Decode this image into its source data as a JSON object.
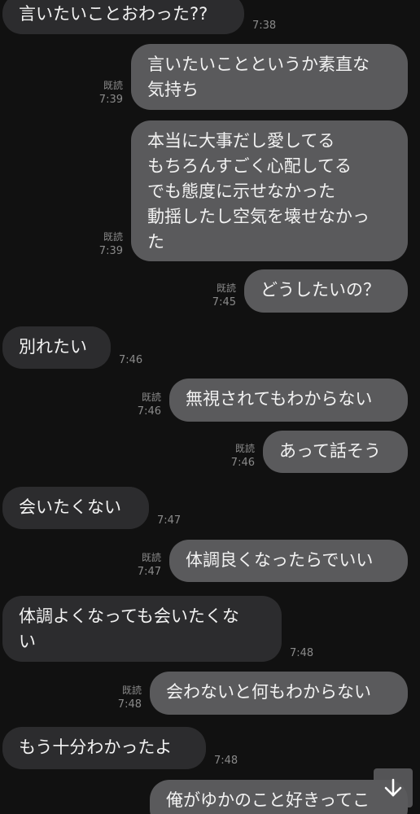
{
  "read_label": "既読",
  "messages": [
    {
      "side": "recv",
      "text": "言いたいことおわった??",
      "time": "7:38"
    },
    {
      "side": "sent",
      "text": "言いたいことというか素直な\n気持ち",
      "time": "7:39",
      "read": true
    },
    {
      "side": "sent",
      "text": "本当に大事だし愛してる\nもちろんすごく心配してる\nでも態度に示せなかった\n動揺したし空気を壊せなかっ\nた",
      "time": "7:39",
      "read": true
    },
    {
      "side": "sent",
      "text": "どうしたいの？",
      "time": "7:45",
      "read": true
    },
    {
      "side": "recv",
      "text": "別れたい",
      "time": "7:46"
    },
    {
      "side": "sent",
      "text": "無視されてもわからない",
      "time": "7:46",
      "read": true
    },
    {
      "side": "sent",
      "text": "あって話そう",
      "time": "7:46",
      "read": true
    },
    {
      "side": "recv",
      "text": "会いたくない",
      "time": "7:47"
    },
    {
      "side": "sent",
      "text": "体調良くなったらでいい",
      "time": "7:47",
      "read": true
    },
    {
      "side": "recv",
      "text": "体調よくなっても会いたくな\nい",
      "time": "7:48"
    },
    {
      "side": "sent",
      "text": "会わないと何もわからない",
      "time": "7:48",
      "read": true
    },
    {
      "side": "recv",
      "text": "もう十分わかったよ",
      "time": "7:48"
    },
    {
      "side": "sent",
      "text": "俺がゆかのこと好きってこ",
      "time": ""
    }
  ],
  "scroll_button_icon": "arrow-down-icon"
}
